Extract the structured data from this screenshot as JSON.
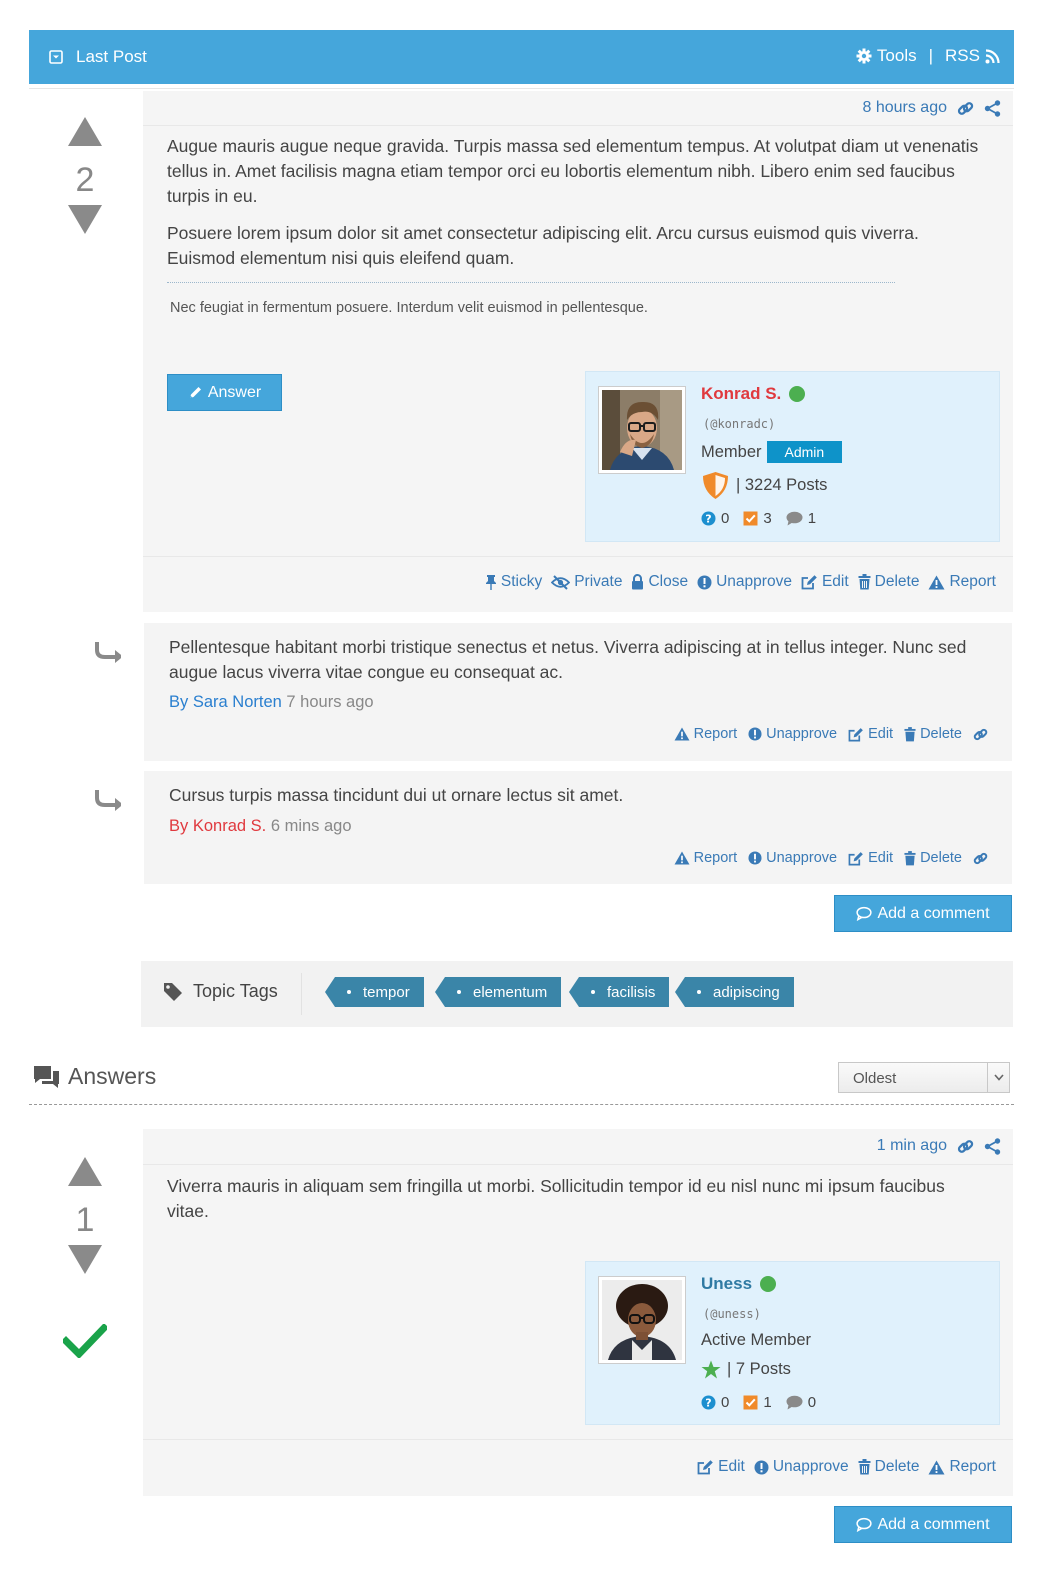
{
  "header": {
    "title": "Last Post",
    "tools_label": "Tools",
    "separator": "|",
    "rss_label": "RSS"
  },
  "topic": {
    "votes": "2",
    "time": "8 hours ago",
    "paragraphs": [
      "Augue mauris augue neque gravida. Turpis massa sed elementum tempus. At volutpat diam ut venenatis tellus in. Amet facilisis magna etiam tempor orci eu lobortis elementum nibh. Libero enim sed faucibus turpis in eu.",
      "Posuere lorem ipsum dolor sit amet consectetur adipiscing elit. Arcu cursus euismod quis viverra. Euismod elementum nisi quis eleifend quam."
    ],
    "signature": "Nec feugiat in fermentum posuere. Interdum velit euismod in pellentesque.",
    "answer_button": "Answer",
    "author": {
      "name": "Konrad S.",
      "handle": "(@konradc)",
      "rank": "Member",
      "badge": "Admin",
      "posts": "| 3224 Posts",
      "questions": "0",
      "answers": "3",
      "comments": "1"
    },
    "actions": [
      "Sticky",
      "Private",
      "Close",
      "Unapprove",
      "Edit",
      "Delete",
      "Report"
    ]
  },
  "comments": [
    {
      "text": "Pellentesque habitant morbi tristique senectus et netus. Viverra adipiscing at in tellus integer. Nunc sed augue lacus viverra vitae congue eu consequat ac.",
      "by": "By Sara Norten",
      "time": "7 hours ago",
      "by_color": "#2a7fcf"
    },
    {
      "text": "Cursus turpis massa tincidunt dui ut ornare lectus sit amet.",
      "by": "By Konrad S.",
      "time": "6 mins ago",
      "by_color": "#e0393e"
    }
  ],
  "comment_actions": [
    "Report",
    "Unapprove",
    "Edit",
    "Delete"
  ],
  "add_comment": "Add a comment",
  "tags": {
    "title": "Topic Tags",
    "items": [
      "tempor",
      "elementum",
      "facilisis",
      "adipiscing"
    ]
  },
  "answers": {
    "title": "Answers",
    "sort_selected": "Oldest"
  },
  "answer1": {
    "votes": "1",
    "time": "1 min ago",
    "text": "Viverra mauris in aliquam sem fringilla ut morbi. Sollicitudin tempor id eu nisl nunc mi ipsum faucibus vitae.",
    "author": {
      "name": "Uness",
      "handle": "(@uness)",
      "rank": "Active Member",
      "posts": "| 7 Posts",
      "questions": "0",
      "answers": "1",
      "comments": "0"
    },
    "actions": [
      "Edit",
      "Unapprove",
      "Delete",
      "Report"
    ]
  },
  "colors": {
    "accent": "#45a6db",
    "link": "#3a7ab6",
    "admin_name": "#e0393e",
    "member_name": "#2f7aa3",
    "tag": "#3a85a8",
    "accepted": "#1aa34a"
  }
}
